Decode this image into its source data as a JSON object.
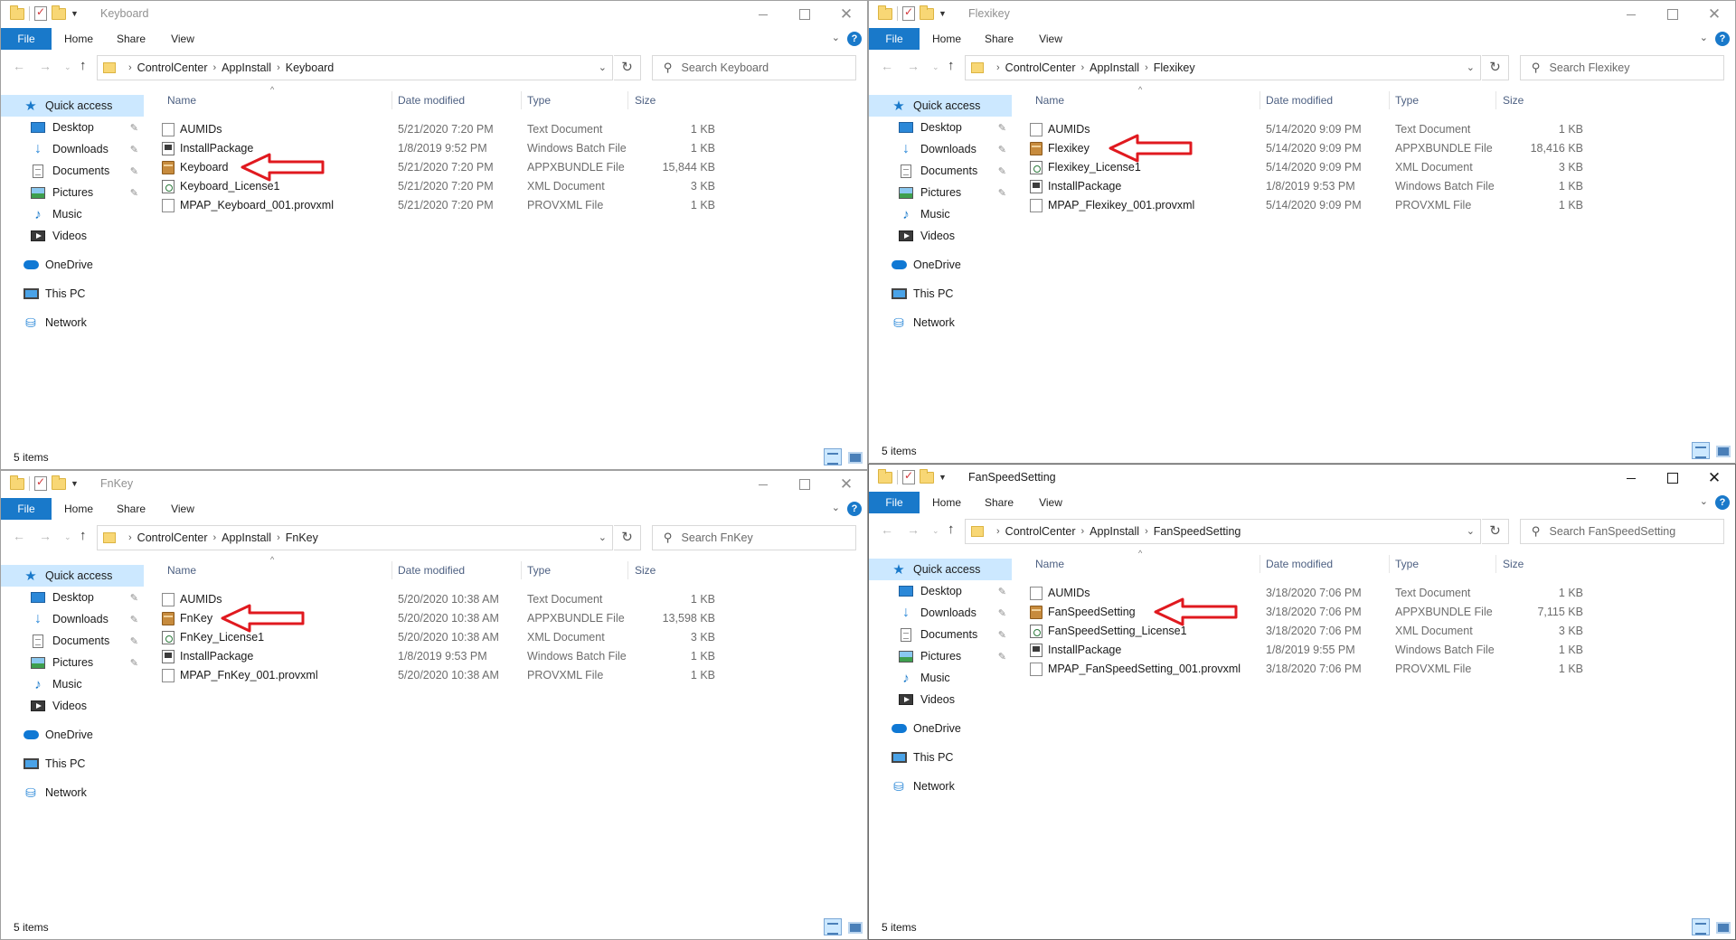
{
  "ribbon": {
    "file": "File",
    "home": "Home",
    "share": "Share",
    "view": "View",
    "help": "?"
  },
  "columns": {
    "name": "Name",
    "date": "Date modified",
    "type": "Type",
    "size": "Size"
  },
  "nav": {
    "items": [
      {
        "label": "Quick access",
        "icon": "star-icon",
        "level": 0,
        "selected": true,
        "pinned": false
      },
      {
        "label": "Desktop",
        "icon": "desktop-icon",
        "level": 1,
        "selected": false,
        "pinned": true
      },
      {
        "label": "Downloads",
        "icon": "download-icon",
        "level": 1,
        "selected": false,
        "pinned": true
      },
      {
        "label": "Documents",
        "icon": "documents-icon",
        "level": 1,
        "selected": false,
        "pinned": true
      },
      {
        "label": "Pictures",
        "icon": "pictures-icon",
        "level": 1,
        "selected": false,
        "pinned": true
      },
      {
        "label": "Music",
        "icon": "music-icon",
        "level": 1,
        "selected": false,
        "pinned": false
      },
      {
        "label": "Videos",
        "icon": "videos-icon",
        "level": 1,
        "selected": false,
        "pinned": false
      },
      {
        "label": "OneDrive",
        "icon": "onedrive-icon",
        "level": 0,
        "selected": false,
        "pinned": false,
        "gap": true
      },
      {
        "label": "This PC",
        "icon": "this-pc-icon",
        "level": 0,
        "selected": false,
        "pinned": false,
        "gap": true
      },
      {
        "label": "Network",
        "icon": "network-icon",
        "level": 0,
        "selected": false,
        "pinned": false,
        "gap": true
      }
    ]
  },
  "colors": {
    "accent": "#1979ca",
    "selection": "#cce8ff",
    "arrow": "#e0191f"
  },
  "windows": [
    {
      "title": "Keyboard",
      "active": false,
      "breadcrumb": [
        "ControlCenter",
        "AppInstall",
        "Keyboard"
      ],
      "search_placeholder": "Search Keyboard",
      "status": "5 items",
      "highlight_row": 2,
      "files": [
        {
          "name": "AUMIDs",
          "date": "5/21/2020 7:20 PM",
          "type": "Text Document",
          "size": "1 KB",
          "icon": "text-file-icon"
        },
        {
          "name": "InstallPackage",
          "date": "1/8/2019 9:52 PM",
          "type": "Windows Batch File",
          "size": "1 KB",
          "icon": "batch-file-icon"
        },
        {
          "name": "Keyboard",
          "date": "5/21/2020 7:20 PM",
          "type": "APPXBUNDLE File",
          "size": "15,844 KB",
          "icon": "appxbundle-icon"
        },
        {
          "name": "Keyboard_License1",
          "date": "5/21/2020 7:20 PM",
          "type": "XML Document",
          "size": "3 KB",
          "icon": "xml-file-icon"
        },
        {
          "name": "MPAP_Keyboard_001.provxml",
          "date": "5/21/2020 7:20 PM",
          "type": "PROVXML File",
          "size": "1 KB",
          "icon": "provxml-file-icon"
        }
      ]
    },
    {
      "title": "Flexikey",
      "active": false,
      "breadcrumb": [
        "ControlCenter",
        "AppInstall",
        "Flexikey"
      ],
      "search_placeholder": "Search Flexikey",
      "status": "5 items",
      "highlight_row": 1,
      "files": [
        {
          "name": "AUMIDs",
          "date": "5/14/2020 9:09 PM",
          "type": "Text Document",
          "size": "1 KB",
          "icon": "text-file-icon"
        },
        {
          "name": "Flexikey",
          "date": "5/14/2020 9:09 PM",
          "type": "APPXBUNDLE File",
          "size": "18,416 KB",
          "icon": "appxbundle-icon"
        },
        {
          "name": "Flexikey_License1",
          "date": "5/14/2020 9:09 PM",
          "type": "XML Document",
          "size": "3 KB",
          "icon": "xml-file-icon"
        },
        {
          "name": "InstallPackage",
          "date": "1/8/2019 9:53 PM",
          "type": "Windows Batch File",
          "size": "1 KB",
          "icon": "batch-file-icon"
        },
        {
          "name": "MPAP_Flexikey_001.provxml",
          "date": "5/14/2020 9:09 PM",
          "type": "PROVXML File",
          "size": "1 KB",
          "icon": "provxml-file-icon"
        }
      ]
    },
    {
      "title": "FnKey",
      "active": false,
      "breadcrumb": [
        "ControlCenter",
        "AppInstall",
        "FnKey"
      ],
      "search_placeholder": "Search FnKey",
      "status": "5 items",
      "highlight_row": 1,
      "files": [
        {
          "name": "AUMIDs",
          "date": "5/20/2020 10:38 AM",
          "type": "Text Document",
          "size": "1 KB",
          "icon": "text-file-icon"
        },
        {
          "name": "FnKey",
          "date": "5/20/2020 10:38 AM",
          "type": "APPXBUNDLE File",
          "size": "13,598 KB",
          "icon": "appxbundle-icon"
        },
        {
          "name": "FnKey_License1",
          "date": "5/20/2020 10:38 AM",
          "type": "XML Document",
          "size": "3 KB",
          "icon": "xml-file-icon"
        },
        {
          "name": "InstallPackage",
          "date": "1/8/2019 9:53 PM",
          "type": "Windows Batch File",
          "size": "1 KB",
          "icon": "batch-file-icon"
        },
        {
          "name": "MPAP_FnKey_001.provxml",
          "date": "5/20/2020 10:38 AM",
          "type": "PROVXML File",
          "size": "1 KB",
          "icon": "provxml-file-icon"
        }
      ]
    },
    {
      "title": "FanSpeedSetting",
      "active": true,
      "breadcrumb": [
        "ControlCenter",
        "AppInstall",
        "FanSpeedSetting"
      ],
      "search_placeholder": "Search FanSpeedSetting",
      "status": "5 items",
      "highlight_row": 1,
      "files": [
        {
          "name": "AUMIDs",
          "date": "3/18/2020 7:06 PM",
          "type": "Text Document",
          "size": "1 KB",
          "icon": "text-file-icon"
        },
        {
          "name": "FanSpeedSetting",
          "date": "3/18/2020 7:06 PM",
          "type": "APPXBUNDLE File",
          "size": "7,115 KB",
          "icon": "appxbundle-icon"
        },
        {
          "name": "FanSpeedSetting_License1",
          "date": "3/18/2020 7:06 PM",
          "type": "XML Document",
          "size": "3 KB",
          "icon": "xml-file-icon"
        },
        {
          "name": "InstallPackage",
          "date": "1/8/2019 9:55 PM",
          "type": "Windows Batch File",
          "size": "1 KB",
          "icon": "batch-file-icon"
        },
        {
          "name": "MPAP_FanSpeedSetting_001.provxml",
          "date": "3/18/2020 7:06 PM",
          "type": "PROVXML File",
          "size": "1 KB",
          "icon": "provxml-file-icon"
        }
      ]
    }
  ]
}
